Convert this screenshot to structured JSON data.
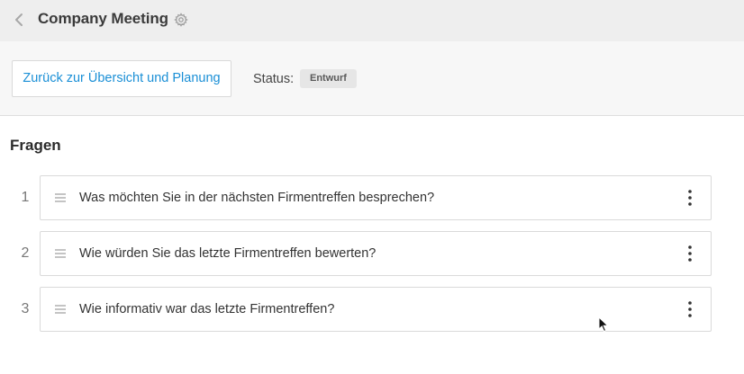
{
  "header": {
    "title": "Company Meeting",
    "back_icon": "chevron-left-icon",
    "settings_icon": "gear-icon"
  },
  "toolbar": {
    "overview_button": "Zurück zur Übersicht und Planung",
    "status_label": "Status:",
    "status_value": "Entwurf"
  },
  "questions_section": {
    "title": "Fragen",
    "items": [
      {
        "number": "1",
        "text": "Was möchten Sie in der nächsten Firmentreffen besprechen?"
      },
      {
        "number": "2",
        "text": "Wie würden Sie das letzte Firmentreffen bewerten?"
      },
      {
        "number": "3",
        "text": "Wie informativ war das letzte Firmentreffen?"
      }
    ]
  },
  "colors": {
    "accent_link": "#1a8fd6",
    "header_bg": "#eeeeee",
    "subbar_bg": "#f7f7f7",
    "badge_bg": "#e6e6e6"
  }
}
